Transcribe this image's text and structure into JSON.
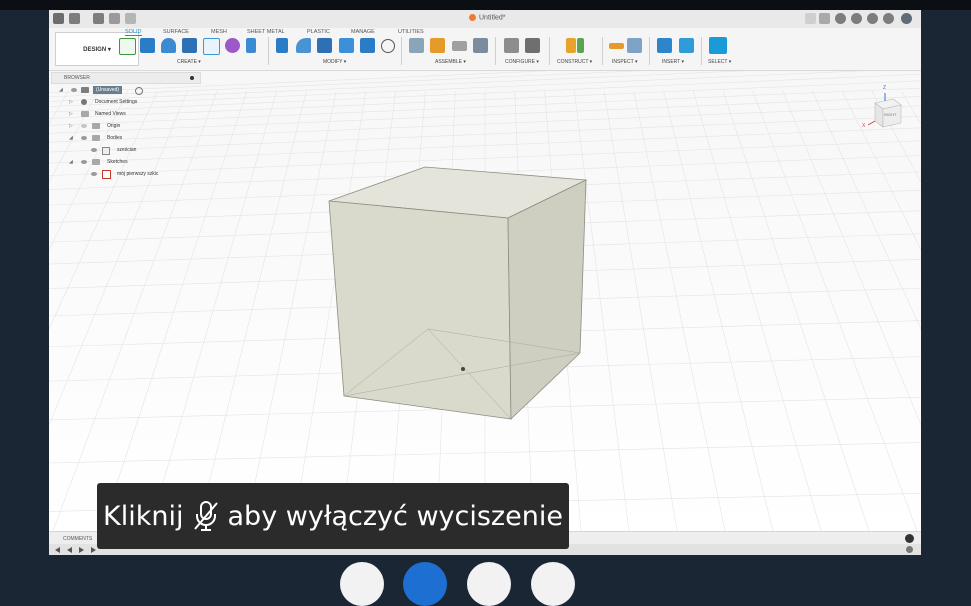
{
  "app": {
    "title": "Untitled*",
    "workspace": "DESIGN ▾"
  },
  "tabs": [
    "SOLID",
    "SURFACE",
    "MESH",
    "SHEET METAL",
    "PLASTIC",
    "MANAGE",
    "UTILITIES"
  ],
  "groups": [
    "CREATE ▾",
    "MODIFY ▾",
    "ASSEMBLE ▾",
    "CONFIGURE ▾",
    "CONSTRUCT ▾",
    "INSPECT ▾",
    "INSERT ▾",
    "SELECT ▾"
  ],
  "browser": {
    "title": "BROWSER",
    "items": [
      {
        "label": "(Unsaved)"
      },
      {
        "label": "Document Settings"
      },
      {
        "label": "Named Views"
      },
      {
        "label": "Origin"
      },
      {
        "label": "Bodies"
      },
      {
        "label": "sześcian"
      },
      {
        "label": "Sketches"
      },
      {
        "label": "mój pierwszy szkic"
      }
    ]
  },
  "viewcube": {
    "face": "RIGHT",
    "axis_z": "Z",
    "axis_x": "X"
  },
  "comments_label": "COMMENTS",
  "toast": {
    "before": "Kliknij",
    "after": "aby wyłączyć wyciszenie"
  },
  "colors": {
    "accent": "#1b8fd6",
    "background": "#1b2634",
    "cube_face": "#dcdcd0"
  }
}
